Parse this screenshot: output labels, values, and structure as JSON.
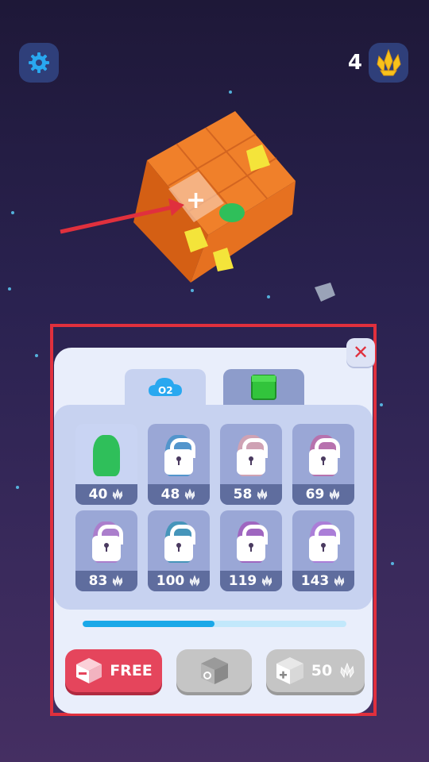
{
  "hud": {
    "gem_count": "4",
    "settings_icon": "gear-icon",
    "gem_icon": "crystal-icon"
  },
  "colors": {
    "panel_bg": "#e9eefb",
    "highlight": "#e0303d",
    "free_button": "#e5455c",
    "progress": "#1aa8e8"
  },
  "tabs": [
    {
      "name": "oxygen",
      "icon": "o2-cloud-icon",
      "label": "O2",
      "active": true
    },
    {
      "name": "blocks",
      "icon": "green-cube-icon",
      "active": false
    }
  ],
  "items": [
    {
      "price": "40",
      "locked": false,
      "icon": "cactus-plant-icon"
    },
    {
      "price": "48",
      "locked": true,
      "icon": "blue-plant-icon"
    },
    {
      "price": "58",
      "locked": true,
      "icon": "pink-flower-icon"
    },
    {
      "price": "69",
      "locked": true,
      "icon": "purple-plant-icon"
    },
    {
      "price": "83",
      "locked": true,
      "icon": "purple-plant-icon"
    },
    {
      "price": "100",
      "locked": true,
      "icon": "blue-bulb-plant-icon"
    },
    {
      "price": "119",
      "locked": true,
      "icon": "purple-plant-icon"
    },
    {
      "price": "143",
      "locked": true,
      "icon": "butterfly-plant-icon"
    }
  ],
  "progress": {
    "fraction": 0.5
  },
  "buttons": {
    "free_label": "FREE",
    "buy_price": "50"
  }
}
